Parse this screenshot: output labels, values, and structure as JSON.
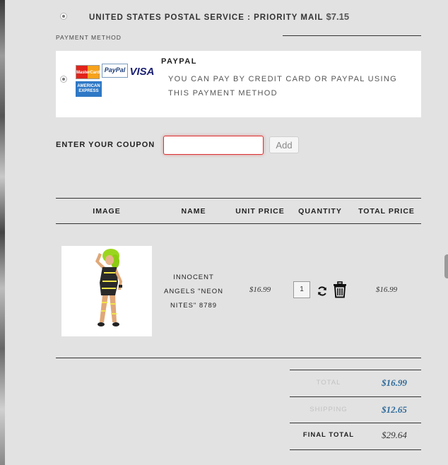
{
  "shipping": {
    "label": "UNITED STATES POSTAL SERVICE : PRIORITY MAIL",
    "price": "$7.15"
  },
  "payment": {
    "section_title": "PAYMENT METHOD",
    "option_title": "PAYPAL",
    "option_description": "YOU CAN PAY BY CREDIT CARD OR PAYPAL USING THIS PAYMENT METHOD",
    "card_logos": {
      "mastercard": "MasterCard",
      "paypal": "PayPal",
      "visa": "VISA",
      "amex_line1": "AMERICAN",
      "amex_line2": "EXPRESS"
    }
  },
  "coupon": {
    "label": "ENTER YOUR COUPON",
    "value": "",
    "button_label": "Add"
  },
  "cart": {
    "headers": [
      "IMAGE",
      "NAME",
      "UNIT PRICE",
      "QUANTITY",
      "TOTAL PRICE"
    ],
    "items": [
      {
        "name": "INNOCENT ANGELS \"NEON NITES\" 8789",
        "unit_price": "$16.99",
        "quantity": "1",
        "total_price": "$16.99"
      }
    ]
  },
  "summary": {
    "total_label": "TOTAL",
    "total_value": "$16.99",
    "shipping_label": "SHIPPING",
    "shipping_value": "$12.65",
    "final_label": "FINAL TOTAL",
    "final_value": "$29.64"
  },
  "colors": {
    "background": "#e2e2e2",
    "accent_blue": "#2e6a9a",
    "input_error_border": "#dd3333",
    "muted_label": "#c2c2c2"
  }
}
